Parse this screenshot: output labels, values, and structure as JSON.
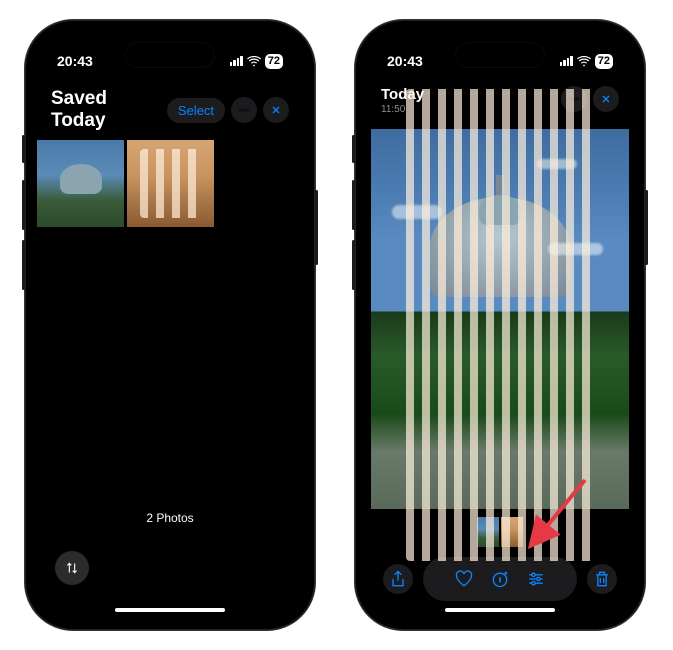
{
  "status": {
    "time": "20:43",
    "battery": "72"
  },
  "left": {
    "title": "Saved Today",
    "select_label": "Select",
    "photo_count": "2 Photos"
  },
  "right": {
    "title": "Today",
    "time": "11:50"
  },
  "colors": {
    "accent": "#0a84ff"
  }
}
